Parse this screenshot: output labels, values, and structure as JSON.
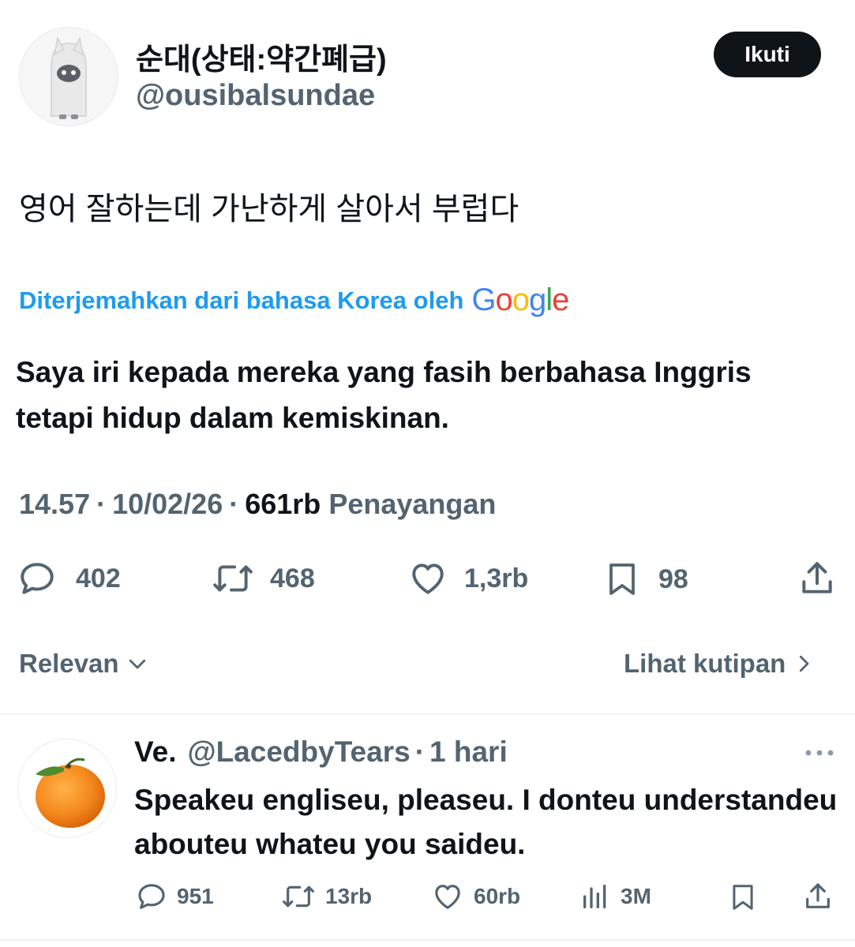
{
  "tweet": {
    "author_name": "순대(상태:약간폐급)",
    "author_handle": "@ousibalsundae",
    "follow_label": "Ikuti",
    "text": "영어 잘하는데 가난하게 살아서 부럽다",
    "translation_note": "Diterjemahkan dari bahasa Korea oleh",
    "translation_provider": "Google",
    "translation": "Saya iri kepada mereka yang fasih berbahasa Inggris tetapi hidup dalam kemiskinan.",
    "time": "14.57",
    "date": "10/02/26",
    "views_count": "661rb",
    "views_label": "Penayangan",
    "separator": "·",
    "replies": "402",
    "retweets": "468",
    "likes": "1,3rb",
    "bookmarks": "98"
  },
  "sort": {
    "label": "Relevan",
    "quotes_link": "Lihat kutipan"
  },
  "reply": {
    "author_name": "Ve.",
    "author_handle": "@LacedbyTears",
    "separator": "·",
    "time": "1 hari",
    "text": "Speakeu engliseu, pleaseu. I donteu understandeu abouteu whateu you saideu.",
    "replies": "951",
    "retweets": "13rb",
    "likes": "60rb",
    "views": "3M"
  },
  "icons": {
    "reply": "reply-icon",
    "retweet": "retweet-icon",
    "like": "heart-icon",
    "bookmark": "bookmark-icon",
    "share": "share-icon",
    "views": "views-icon",
    "more": "more-icon",
    "chevron_down": "chevron-down-icon",
    "chevron_right": "chevron-right-icon"
  },
  "colors": {
    "accent": "#1d9bf0",
    "text_primary": "#0f1419",
    "text_secondary": "#536471",
    "button_bg": "#0f1419",
    "divider": "#eff3f4"
  }
}
